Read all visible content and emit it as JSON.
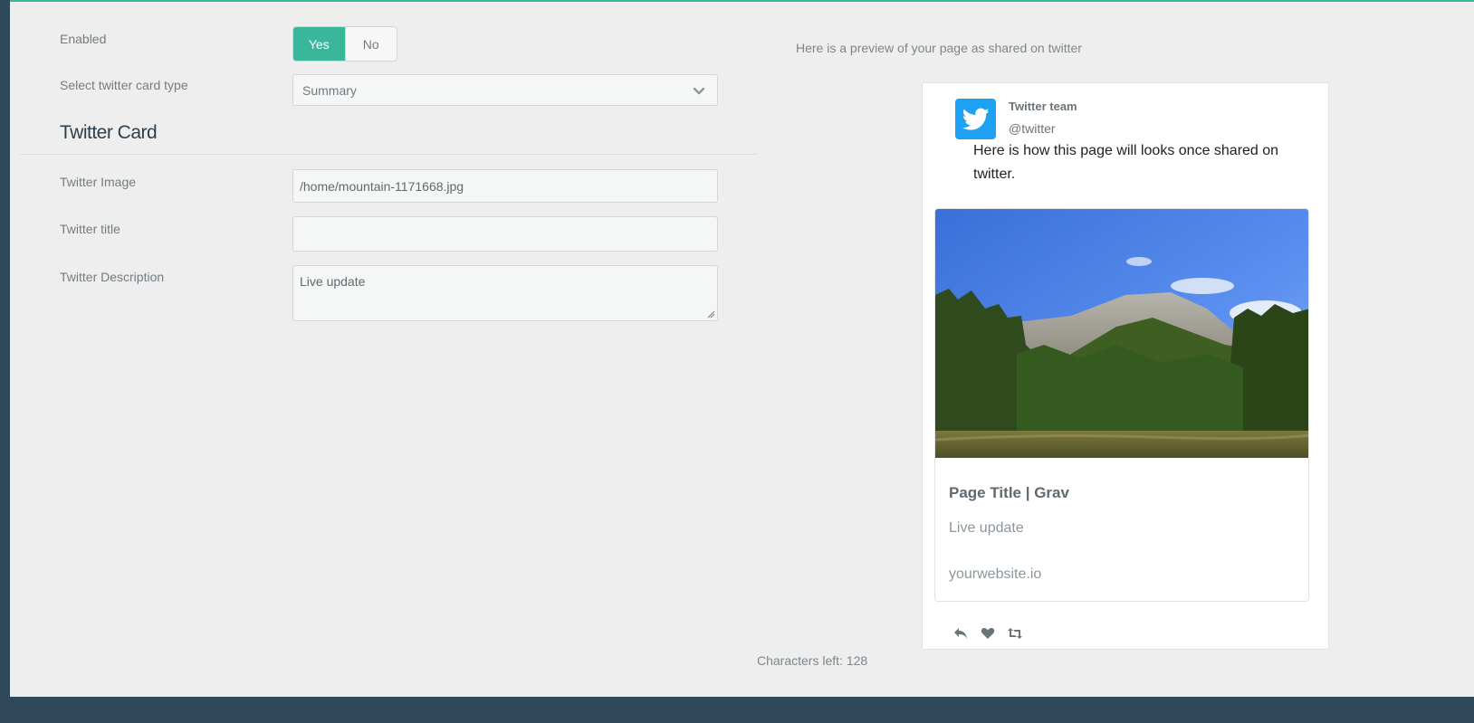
{
  "colors": {
    "accent": "#3ab79b",
    "sidebar": "#30495a",
    "twitter_blue": "#1da1f2"
  },
  "form": {
    "enabled": {
      "label": "Enabled",
      "yes": "Yes",
      "no": "No",
      "selected": "Yes"
    },
    "card_type": {
      "label": "Select twitter card type",
      "value": "Summary"
    },
    "section_title": "Twitter Card",
    "image": {
      "label": "Twitter Image",
      "value": "/home/mountain-1171668.jpg"
    },
    "title": {
      "label": "Twitter title",
      "value": ""
    },
    "description": {
      "label": "Twitter Description",
      "value": "Live update"
    }
  },
  "preview": {
    "note": "Here is a preview of your page as shared on twitter",
    "tweet": {
      "name": "Twitter team",
      "handle": "@twitter",
      "text": "Here is how this page will looks once shared on twitter.",
      "card_title": "Page Title | Grav",
      "card_description": "Live update",
      "card_url": "yourwebsite.io"
    },
    "icons": [
      "reply-icon",
      "heart-icon",
      "retweet-icon"
    ]
  },
  "characters_left": "Characters left: 128"
}
